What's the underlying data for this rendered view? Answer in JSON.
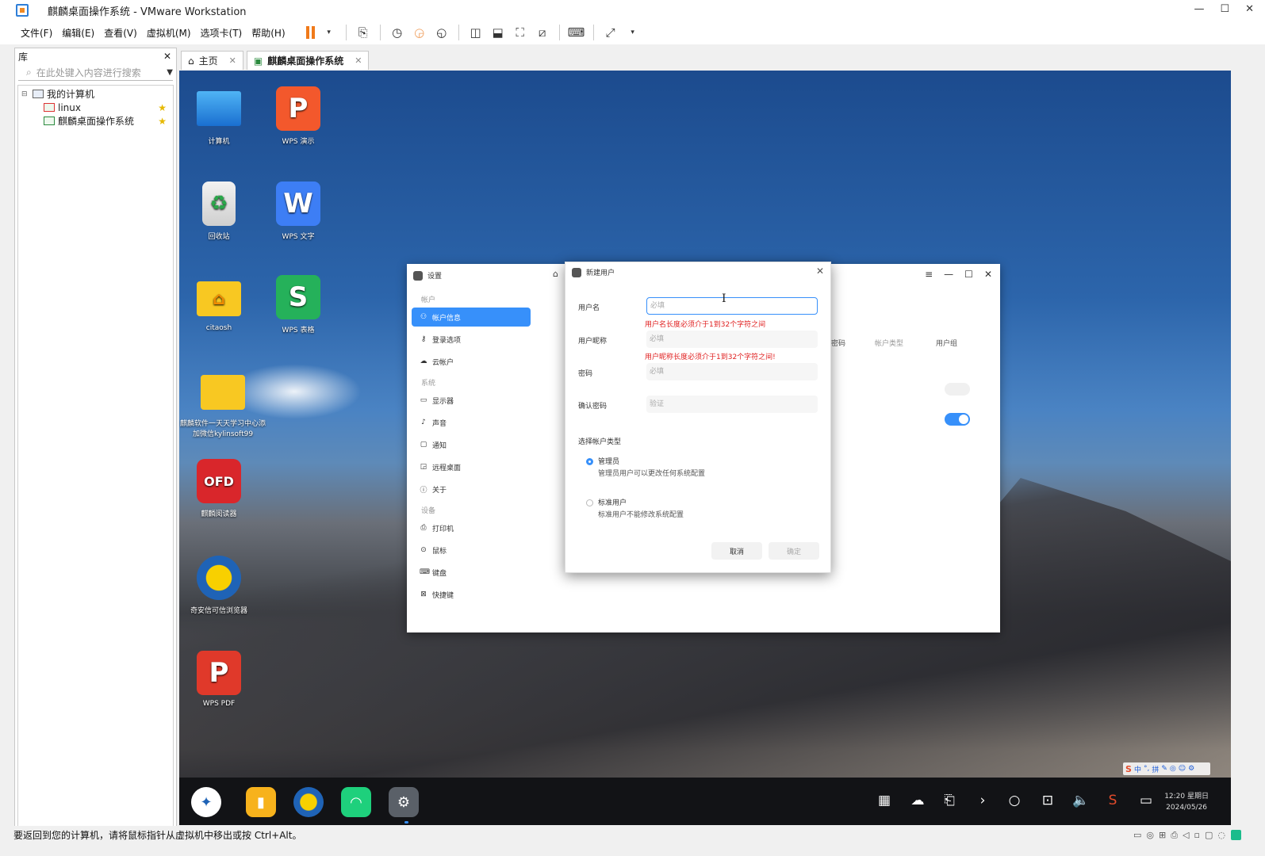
{
  "window": {
    "title": "麒麟桌面操作系统 - VMware Workstation",
    "minimize": "—",
    "maximize": "☐",
    "close": "✕"
  },
  "menu": {
    "items": [
      "文件(F)",
      "编辑(E)",
      "查看(V)",
      "虚拟机(M)",
      "选项卡(T)",
      "帮助(H)"
    ]
  },
  "library": {
    "title": "库",
    "close": "✕",
    "search_placeholder": "在此处键入内容进行搜索",
    "tree": {
      "root": "我的计算机",
      "vms": [
        "linux",
        "麒麟桌面操作系统"
      ]
    }
  },
  "tabs": [
    {
      "label": "主页"
    },
    {
      "label": "麒麟桌面操作系统"
    }
  ],
  "desktop": {
    "icons": [
      {
        "label": "计算机",
        "glyph": ""
      },
      {
        "label": "WPS 演示",
        "glyph": "P"
      },
      {
        "label": "回收站",
        "glyph": "♻"
      },
      {
        "label": "WPS 文字",
        "glyph": "W"
      },
      {
        "label": "citaosh",
        "glyph": "⌂"
      },
      {
        "label": "WPS 表格",
        "glyph": "S"
      },
      {
        "label": "麒麟软件一天天学习中心添加微信kylinsoft99",
        "glyph": ""
      },
      {
        "label": "麒麟阅读器",
        "glyph": "OFD"
      },
      {
        "label": "奇安信可信浏览器",
        "glyph": ""
      },
      {
        "label": "WPS PDF",
        "glyph": "P"
      }
    ]
  },
  "settings": {
    "title": "设置",
    "sections": [
      {
        "name": "帐户",
        "items": [
          "帐户信息",
          "登录选项",
          "云帐户"
        ]
      },
      {
        "name": "系统",
        "items": [
          "显示器",
          "声音",
          "通知",
          "远程桌面",
          "关于"
        ]
      },
      {
        "name": "设备",
        "items": [
          "打印机",
          "鼠标",
          "键盘",
          "快捷键"
        ]
      }
    ],
    "columns": [
      "密码",
      "帐户类型",
      "用户组"
    ]
  },
  "dialog": {
    "title": "新建用户",
    "username_label": "用户名",
    "username_placeholder": "必填",
    "username_error": "用户名长度必须介于1到32个字符之间",
    "nickname_label": "用户昵称",
    "nickname_placeholder": "必填",
    "nickname_error": "用户昵称长度必须介于1到32个字符之间!",
    "password_label": "密码",
    "password_placeholder": "必填",
    "confirm_label": "确认密码",
    "confirm_placeholder": "验证",
    "account_type_label": "选择帐户类型",
    "admin_title": "管理员",
    "admin_desc": "管理员用户可以更改任何系统配置",
    "standard_title": "标准用户",
    "standard_desc": "标准用户不能修改系统配置",
    "cancel": "取消",
    "ok": "确定"
  },
  "ime": {
    "items": [
      "S",
      "中",
      "°,",
      "拼",
      "✎",
      "◎",
      "☺",
      "⚙"
    ]
  },
  "taskbar": {
    "clock_time": "12:20 星期日",
    "clock_date": "2024/05/26"
  },
  "status": {
    "text": "要返回到您的计算机，请将鼠标指针从虚拟机中移出或按 Ctrl+Alt。"
  },
  "colors": {
    "accent": "#3790fa",
    "error": "#e02020",
    "vmware_pause": "#f07a1a"
  }
}
